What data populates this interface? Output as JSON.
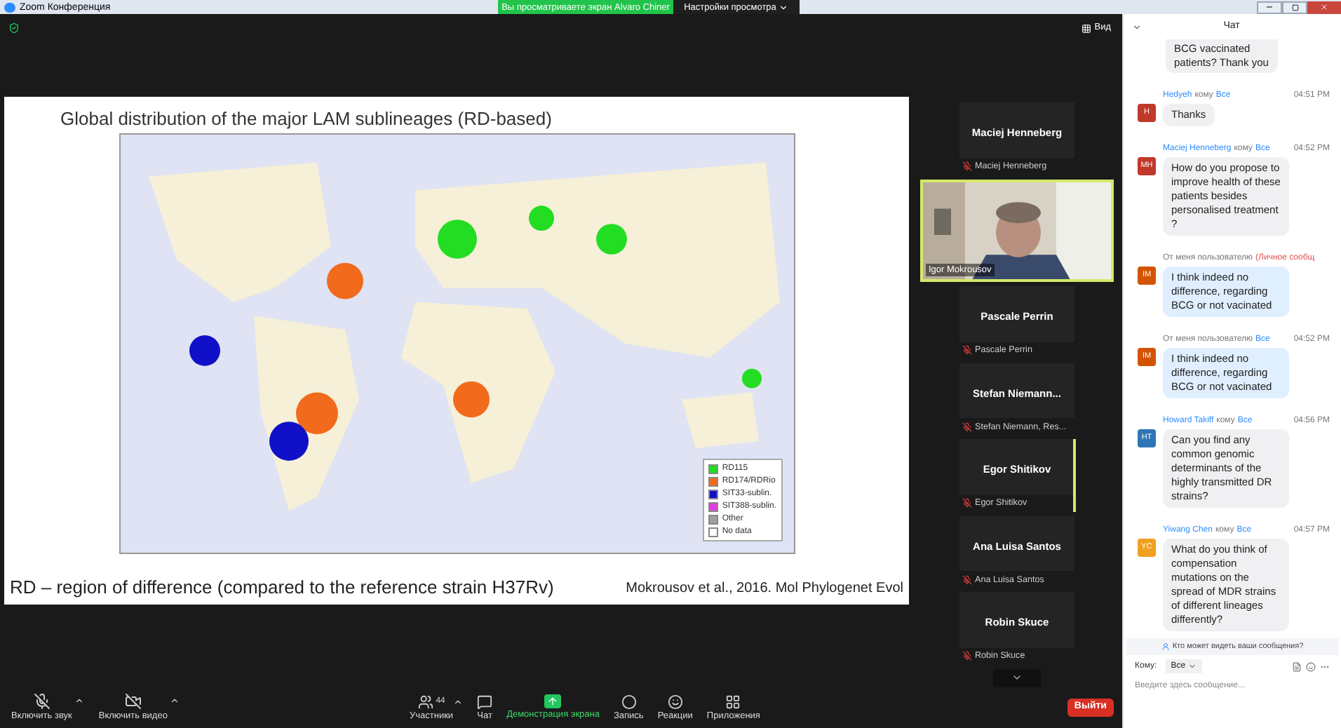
{
  "title_bar": {
    "title": "Zoom Конференция",
    "banner": "Вы просматриваете экран Alvaro Chiner",
    "view_settings": "Настройки просмотра"
  },
  "view_button": "Вид",
  "slide": {
    "title": "Global distribution of the major LAM sublineages (RD-based)",
    "footer_left": "RD – region of difference (compared to the reference strain H37Rv)",
    "footer_right": "Mokrousov et al., 2016. Mol Phylogenet Evol",
    "legend": [
      {
        "label": "RD115",
        "color": "#22dd22"
      },
      {
        "label": "RD174/RDRio",
        "color": "#f26b1d"
      },
      {
        "label": "SIT33-sublin.",
        "color": "#1010c8"
      },
      {
        "label": "SIT388-sublin.",
        "color": "#e040e0"
      },
      {
        "label": "Other",
        "color": "#a0a0a0"
      },
      {
        "label": "No data",
        "color": "#ffffff"
      }
    ]
  },
  "participants": [
    {
      "kind": "name",
      "name": "Maciej Henneberg",
      "label": "Maciej Henneberg",
      "speaking": false
    },
    {
      "kind": "video",
      "label": "Igor Mokrousov",
      "speaking": false
    },
    {
      "kind": "name",
      "name": "Pascale Perrin",
      "label": "Pascale Perrin",
      "speaking": false
    },
    {
      "kind": "name",
      "name": "Stefan  Niemann...",
      "label": "Stefan Niemann, Res...",
      "speaking": false
    },
    {
      "kind": "name",
      "name": "Egor Shitikov",
      "label": "Egor Shitikov",
      "speaking": true
    },
    {
      "kind": "name",
      "name": "Ana Luisa Santos",
      "label": "Ana Luisa Santos",
      "speaking": false
    },
    {
      "kind": "name",
      "name": "Robin Skuce",
      "label": "Robin Skuce",
      "speaking": false
    }
  ],
  "chat": {
    "title": "Чат",
    "messages": [
      {
        "kind": "continued",
        "text": "BCG vaccinated patients? Thank you"
      },
      {
        "kind": "public",
        "sender": "Hedyeh",
        "to_word": "кому",
        "to": "Все",
        "time": "04:51 PM",
        "initials": "H",
        "color": "#c0392b",
        "text": "Thanks"
      },
      {
        "kind": "public",
        "sender": "Maciej Henneberg",
        "to_word": "кому",
        "to": "Все",
        "time": "04:52 PM",
        "initials": "MH",
        "color": "#c0392b",
        "text": "How do you propose to improve health of these patients  besides personalised treatment ?"
      },
      {
        "kind": "private",
        "sender": "От меня пользователю",
        "to": "(Личное сообщ",
        "initials": "IM",
        "color": "#d35400",
        "text": "I think indeed no difference, regarding BCG or not vacinated"
      },
      {
        "kind": "public",
        "sender": "От меня пользователю",
        "to": "Все",
        "time": "04:52 PM",
        "initials": "IM",
        "color": "#d35400",
        "text": "I think indeed no difference, regarding BCG or not vacinated"
      },
      {
        "kind": "public",
        "sender": "Howard Takiff",
        "to_word": "кому",
        "to": "Все",
        "time": "04:56 PM",
        "initials": "HT",
        "color": "#2e75b6",
        "text": "Can you find any common genomic determinants of the highly transmitted DR strains?"
      },
      {
        "kind": "public",
        "sender": "Yiwang Chen",
        "to_word": "кому",
        "to": "Все",
        "time": "04:57 PM",
        "initials": "YC",
        "color": "#f0a020",
        "text": "What do you think of compensation mutations on the spread of MDR strains of different lineages differently?"
      }
    ],
    "privacy_note": "Кто может видеть ваши сообщения?",
    "to_label": "Кому:",
    "to_value": "Все",
    "placeholder": "Введите здесь сообщение..."
  },
  "toolbar": {
    "left": [
      {
        "kind": "mic",
        "label": "Включить звук"
      },
      {
        "kind": "video",
        "label": "Включить видео"
      }
    ],
    "center": [
      {
        "kind": "participants",
        "label": "Участники",
        "count": "44",
        "selected": false
      },
      {
        "kind": "chat",
        "label": "Чат",
        "selected": false
      },
      {
        "kind": "share",
        "label": "Демонстрация экрана",
        "selected": true
      },
      {
        "kind": "record",
        "label": "Запись",
        "selected": false
      },
      {
        "kind": "reactions",
        "label": "Реакции",
        "selected": false
      },
      {
        "kind": "apps",
        "label": "Приложения",
        "selected": false
      }
    ],
    "leave": "Выйти"
  }
}
